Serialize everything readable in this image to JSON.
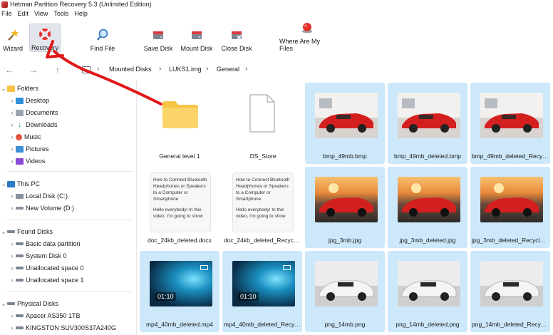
{
  "window": {
    "title": "Hetman Partition Recovery 5.3 (Unlimited Edition)"
  },
  "menu": [
    "File",
    "Edit",
    "View",
    "Tools",
    "Help"
  ],
  "toolbar": {
    "wizard": "Wizard",
    "recovery": "Recovery",
    "find_file": "Find File",
    "save_disk": "Save Disk",
    "mount_disk": "Mount Disk",
    "close_disk": "Close Disk",
    "where_files": "Where Are My Files"
  },
  "breadcrumb": [
    "Mounted Disks",
    "LUKS1.img",
    "General"
  ],
  "tree": {
    "folders": "Folders",
    "folder_items": [
      "Desktop",
      "Documents",
      "Downloads",
      "Music",
      "Pictures",
      "Videos"
    ],
    "this_pc": "This PC",
    "pc_items": [
      "Local Disk (C:)",
      "New Volume (D:)"
    ],
    "found_disks": "Found Disks",
    "found_items": [
      "Basic data partition",
      "System Disk 0",
      "Unallocated space 0",
      "Unallocated space 1"
    ],
    "physical_disks": "Physical Disks",
    "physical_items": [
      "Apacer AS350 1TB",
      "KINGSTON SUV300S37A240G"
    ]
  },
  "files": [
    {
      "name": "General level 1",
      "kind": "folder"
    },
    {
      "name": ".DS_Store",
      "kind": "blank"
    },
    {
      "name": "bmp_49mb.bmp",
      "kind": "car-red"
    },
    {
      "name": "bmp_49mb_deleted.bmp",
      "kind": "car-red"
    },
    {
      "name": "bmp_49mb_deleted_Recycl...",
      "kind": "car-red"
    },
    {
      "name": "doc_24kb_deleted.docx",
      "kind": "doc"
    },
    {
      "name": "doc_24kb_deleted_Recycle....",
      "kind": "doc"
    },
    {
      "name": "jpg_3mb.jpg",
      "kind": "car-sunset"
    },
    {
      "name": "jpg_3mb_deleted.jpg",
      "kind": "car-sunset"
    },
    {
      "name": "jpg_3mb_deleted_Recycle.j...",
      "kind": "car-sunset"
    },
    {
      "name": "mp4_40mb_deleted.mp4",
      "kind": "video"
    },
    {
      "name": "mp4_40mb_deleted_Recycl...",
      "kind": "video"
    },
    {
      "name": "png_14mb.png",
      "kind": "car-white"
    },
    {
      "name": "png_14mb_deleted.png",
      "kind": "car-white"
    },
    {
      "name": "png_14mb_deleted_Recycl...",
      "kind": "car-white"
    }
  ],
  "doc_preview_text": "How to Connect Bluetooth Headphones or Speakers to a Computer or Smartphone",
  "doc_preview_text2": "Hello everybody! In this video, I'm going to show",
  "video_duration": "01:10",
  "colors": {
    "selection": "#cde8fb",
    "folder": "#f6c445",
    "annotation": "#e01818"
  }
}
